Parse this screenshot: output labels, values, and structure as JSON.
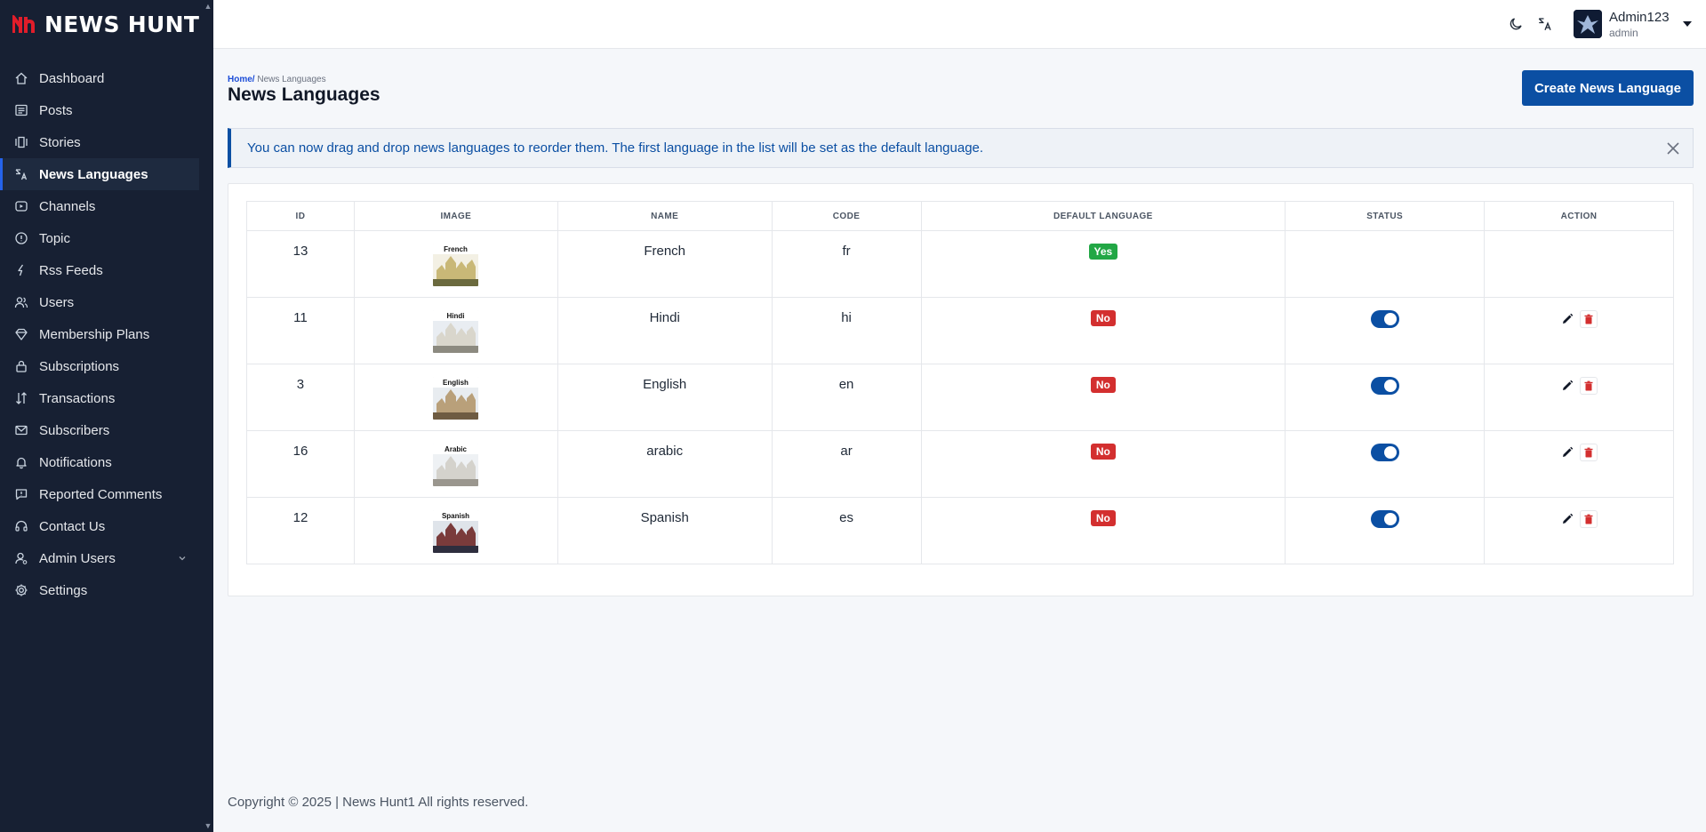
{
  "brand": {
    "name": "NEWS HUNT"
  },
  "sidebar": {
    "items": [
      {
        "label": "Dashboard",
        "icon": "home-icon",
        "active": false
      },
      {
        "label": "Posts",
        "icon": "posts-icon",
        "active": false
      },
      {
        "label": "Stories",
        "icon": "stories-icon",
        "active": false
      },
      {
        "label": "News Languages",
        "icon": "translate-icon",
        "active": true
      },
      {
        "label": "Channels",
        "icon": "play-icon",
        "active": false
      },
      {
        "label": "Topic",
        "icon": "topic-icon",
        "active": false
      },
      {
        "label": "Rss Feeds",
        "icon": "rss-icon",
        "active": false
      },
      {
        "label": "Users",
        "icon": "users-icon",
        "active": false
      },
      {
        "label": "Membership Plans",
        "icon": "diamond-icon",
        "active": false
      },
      {
        "label": "Subscriptions",
        "icon": "lock-icon",
        "active": false
      },
      {
        "label": "Transactions",
        "icon": "sort-icon",
        "active": false
      },
      {
        "label": "Subscribers",
        "icon": "mail-icon",
        "active": false
      },
      {
        "label": "Notifications",
        "icon": "bell-icon",
        "active": false
      },
      {
        "label": "Reported Comments",
        "icon": "comment-alert-icon",
        "active": false
      },
      {
        "label": "Contact Us",
        "icon": "headset-icon",
        "active": false
      },
      {
        "label": "Admin Users",
        "icon": "admin-user-icon",
        "active": false
      },
      {
        "label": "Settings",
        "icon": "gear-icon",
        "active": false
      }
    ]
  },
  "header": {
    "user_name": "Admin123",
    "user_role": "admin"
  },
  "breadcrumb": {
    "home": "Home/",
    "current": " News Languages"
  },
  "page_title": "News Languages",
  "create_button": "Create News Language",
  "alert": "You can now drag and drop news languages to reorder them. The first language in the list will be set as the default language.",
  "table": {
    "headers": [
      "ID",
      "IMAGE",
      "NAME",
      "CODE",
      "DEFAULT LANGUAGE",
      "STATUS",
      "ACTION"
    ],
    "rows": [
      {
        "id": "13",
        "image_label": "French",
        "name": "French",
        "code": "fr",
        "default": "Yes",
        "status_on": null,
        "has_actions": false
      },
      {
        "id": "11",
        "image_label": "Hindi",
        "name": "Hindi",
        "code": "hi",
        "default": "No",
        "status_on": true,
        "has_actions": true
      },
      {
        "id": "3",
        "image_label": "English",
        "name": "English",
        "code": "en",
        "default": "No",
        "status_on": true,
        "has_actions": true
      },
      {
        "id": "16",
        "image_label": "Arabic",
        "name": "arabic",
        "code": "ar",
        "default": "No",
        "status_on": true,
        "has_actions": true
      },
      {
        "id": "12",
        "image_label": "Spanish",
        "name": "Spanish",
        "code": "es",
        "default": "No",
        "status_on": true,
        "has_actions": true
      }
    ]
  },
  "footer": "Copyright © 2025 | News Hunt1 All rights reserved.",
  "colors": {
    "sidebar_bg": "#172033",
    "primary": "#0b4fa3",
    "yes": "#22a745",
    "no": "#d32f2f"
  }
}
